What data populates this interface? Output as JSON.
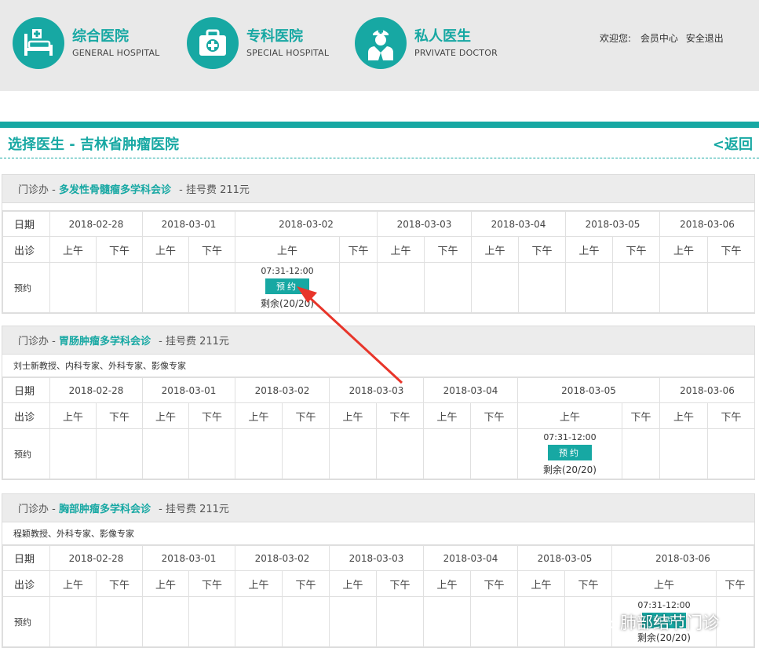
{
  "header": {
    "nav": [
      {
        "title": "综合医院",
        "sub": "GENERAL HOSPITAL",
        "icon": "hospital-bed-icon"
      },
      {
        "title": "专科医院",
        "sub": "SPECIAL HOSPITAL",
        "icon": "first-aid-kit-icon"
      },
      {
        "title": "私人医生",
        "sub": "PRVIVATE DOCTOR",
        "icon": "doctor-icon"
      }
    ],
    "welcome": "欢迎您:",
    "member_center": "会员中心",
    "logout": "安全退出"
  },
  "page": {
    "title": "选择医生 - 吉林省肿瘤医院",
    "back": "<返回"
  },
  "labels": {
    "dept_prefix": "门诊办 -",
    "fee_label": "- 挂号费 211元",
    "date": "日期",
    "session": "出诊",
    "booking": "预约",
    "am": "上午",
    "pm": "下午",
    "book_btn": "预约",
    "slot_time": "07:31-12:00",
    "remaining": "剩余(20/20)"
  },
  "clinics": [
    {
      "name": "多发性骨髓瘤多学科会诊",
      "doctors": "",
      "dates": [
        "2018-02-28",
        "2018-03-01",
        "2018-03-02",
        "2018-03-03",
        "2018-03-04",
        "2018-03-05",
        "2018-03-06"
      ]
    },
    {
      "name": "胃肠肿瘤多学科会诊",
      "doctors": "刘士新教授、内科专家、外科专家、影像专家",
      "dates": [
        "2018-02-28",
        "2018-03-01",
        "2018-03-02",
        "2018-03-03",
        "2018-03-04",
        "2018-03-05",
        "2018-03-06"
      ]
    },
    {
      "name": "胸部肿瘤多学科会诊",
      "doctors": "程颖教授、外科专家、影像专家",
      "dates": [
        "2018-02-28",
        "2018-03-01",
        "2018-03-02",
        "2018-03-03",
        "2018-03-04",
        "2018-03-05",
        "2018-03-06"
      ]
    }
  ],
  "watermark": "肺部结节门诊",
  "colors": {
    "accent": "#17a8a3",
    "arrow": "#e8352a",
    "header_bg": "#e9e9e9"
  }
}
